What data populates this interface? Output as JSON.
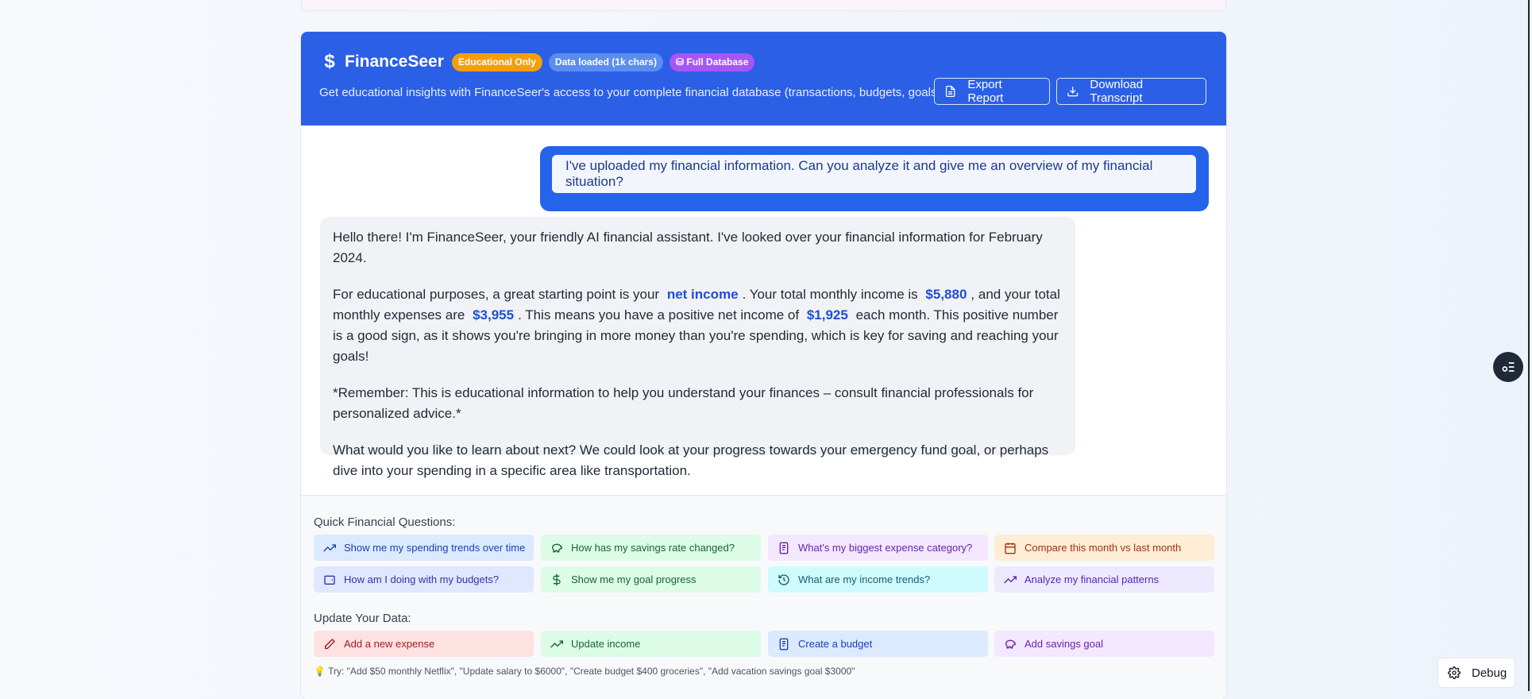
{
  "header": {
    "brand_icon": "dollar-sign-icon",
    "title": "FinanceSeer",
    "badges": {
      "educational": "Educational Only",
      "data_loaded": "Data loaded (1k chars)",
      "database": "Full Database"
    },
    "subtitle": "Get educational insights with FinanceSeer's access to your complete financial database (transactions, budgets, goals)",
    "export_label": "Export Report",
    "transcript_label": "Download Transcript"
  },
  "chat": {
    "user_message": "I've uploaded my financial information. Can you analyze it and give me an overview of my financial situation?",
    "assistant": {
      "p1": "Hello there! I'm FinanceSeer, your friendly AI financial assistant. I've looked over your financial information for February 2024.",
      "p2_a": "For educational purposes, a great starting point is your",
      "p2_hl1": "net income",
      "p2_b": ". Your total monthly income is",
      "p2_hl2": "$5,880",
      "p2_c": ", and your total monthly expenses are",
      "p2_hl3": "$3,955",
      "p2_d": ". This means you have a positive net income of",
      "p2_hl4": "$1,925",
      "p2_e": "each month. This positive number is a good sign, as it shows you're bringing in more money than you're spending, which is key for saving and reaching your goals!",
      "p3": "*Remember: This is educational information to help you understand your finances – consult financial professionals for personalized advice.*",
      "p4": "What would you like to learn about next? We could look at your progress towards your emergency fund goal, or perhaps dive into your spending in a specific area like transportation."
    }
  },
  "quick_questions": {
    "label": "Quick Financial Questions:",
    "items": [
      {
        "label": "Show me my spending trends over time",
        "icon": "trending-up-icon"
      },
      {
        "label": "How has my savings rate changed?",
        "icon": "piggy-bank-icon"
      },
      {
        "label": "What's my biggest expense category?",
        "icon": "receipt-icon"
      },
      {
        "label": "Compare this month vs last month",
        "icon": "calendar-icon"
      },
      {
        "label": "How am I doing with my budgets?",
        "icon": "wallet-icon"
      },
      {
        "label": "Show me my goal progress",
        "icon": "dollar-sign-icon"
      },
      {
        "label": "What are my income trends?",
        "icon": "history-icon"
      },
      {
        "label": "Analyze my financial patterns",
        "icon": "trending-up-icon"
      }
    ]
  },
  "update_data": {
    "label": "Update Your Data:",
    "items": [
      {
        "label": "Add a new expense",
        "icon": "pencil-icon"
      },
      {
        "label": "Update income",
        "icon": "trending-up-icon"
      },
      {
        "label": "Create a budget",
        "icon": "receipt-icon"
      },
      {
        "label": "Add savings goal",
        "icon": "piggy-bank-icon"
      }
    ],
    "tip_icon": "lightbulb-icon",
    "tip": "Try: \"Add $50 monthly Netflix\", \"Update salary to $6000\", \"Create budget $400 groceries\", \"Add vacation savings goal $3000\""
  },
  "floating": {
    "debug_label": "Debug",
    "settings_icon": "gear-icon",
    "toggle_icon": "toggle-list-icon"
  }
}
